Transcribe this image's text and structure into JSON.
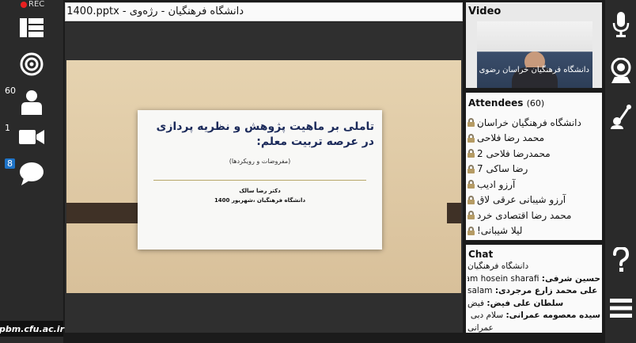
{
  "recording": {
    "label": "REC"
  },
  "left_toolbar": {
    "participants_count": "60",
    "cameras_count": "1",
    "chat_count": "8",
    "icons": [
      "layout-icon",
      "broadcast-icon",
      "user-icon",
      "camera-icon",
      "chat-icon"
    ]
  },
  "watermark": "pbm.cfu.ac.ir",
  "stage": {
    "title": "1400.pptx - دانشگاه فرهنگیان - رژه‌وی",
    "slide": {
      "title": "تاملی بر ماهیت  پژوهش و نظریه پردازی در عرصه تربیت معلم:",
      "subtitle": "(مفروضات و رویکردها)",
      "author": "دکتر رضا سالک",
      "university": "دانشگاه فرهنگیان ،شهریور 1400",
      "colors": {
        "background": "#dcc7a2",
        "band": "#3f3126",
        "title": "#1b2a5a"
      }
    }
  },
  "video": {
    "title": "Video",
    "caption": "دانشگاه فرهنگیان خراسان رضوی"
  },
  "attendees": {
    "title": "Attendees",
    "count": "(60)",
    "list": [
      "دانشگاه فرهنگیان خراسان",
      "محمد رضا فلاحی",
      "محمدرضا فلاحی 2",
      "رضا ساکی 7",
      "آرزو ادیب",
      "آرزو شیبانی عرقی لاق",
      "محمد رضا اقتصادی خرد",
      "لیلا شیبانی!",
      "..."
    ]
  },
  "chat": {
    "title": "Chat",
    "messages": [
      {
        "who": "",
        "text": "دانشگاه فرهنگیان"
      },
      {
        "who": "حسین شرفی:",
        "text": "salam hosein sharafi"
      },
      {
        "who": "علی محمد زارع مرجردی:",
        "text": "salam"
      },
      {
        "who": "سلطان علی فیض:",
        "text": "فیض"
      },
      {
        "who": "سیده معصومه عمرانی:",
        "text": "سلام دبی معصوم"
      },
      {
        "who": "",
        "text": "عمرانی"
      }
    ]
  },
  "right_toolbar": {
    "icons": [
      "microphone-icon",
      "webcam-icon",
      "raise-hand-icon",
      "help-icon",
      "menu-icon"
    ]
  }
}
